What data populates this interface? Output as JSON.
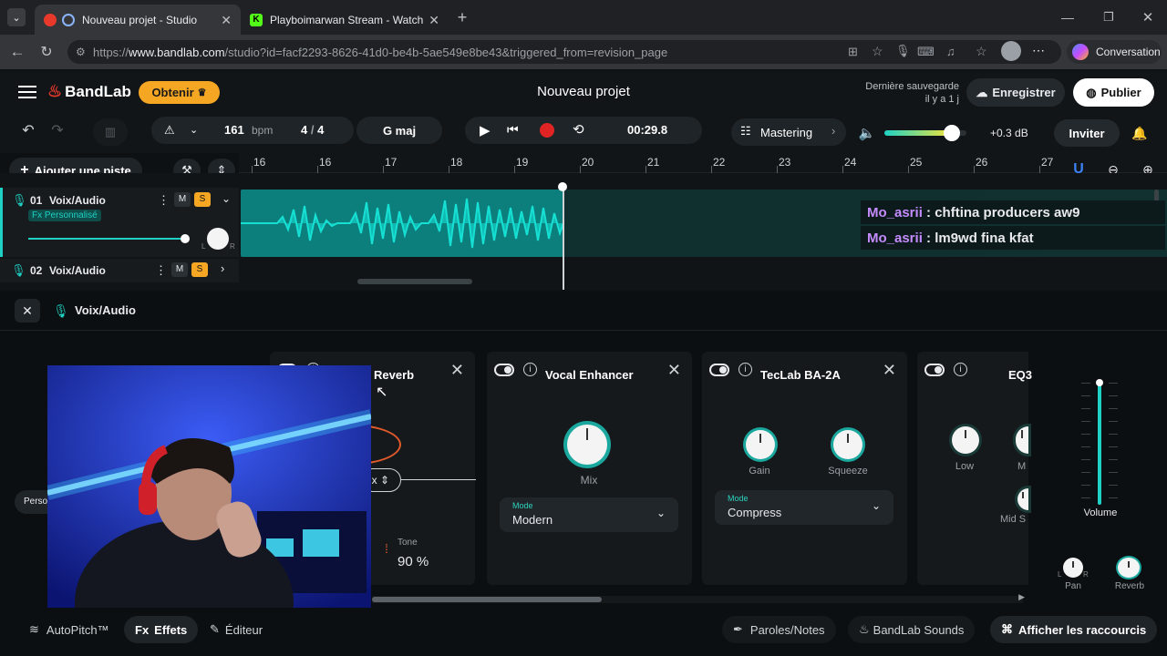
{
  "browser": {
    "tabs": [
      {
        "title": "Nouveau projet - Studio",
        "active": true
      },
      {
        "title": "Playboimarwan Stream - Watch Li",
        "active": false
      }
    ],
    "url_prefix": "https://",
    "url_domain": "www.bandlab.com",
    "url_path": "/studio?id=facf2293-8626-41d0-be4b-5ae549e8be43&triggered_from=revision_page",
    "copilot_label": "Conversation"
  },
  "app": {
    "brand": "BandLab",
    "get_button": "Obtenir",
    "project_title": "Nouveau projet",
    "last_saved_label": "Dernière sauvegarde",
    "last_saved_time": "il y a 1 j",
    "save_button": "Enregistrer",
    "publish_button": "Publier"
  },
  "toolbar": {
    "tempo": "161",
    "tempo_unit": "bpm",
    "time_sig_num": "4",
    "time_sig_sep": "/",
    "time_sig_den": "4",
    "key": "G maj",
    "time": "00:29.8",
    "mastering": "Mastering",
    "master_db": "+0.3 dB",
    "invite": "Inviter",
    "add_track": "Ajouter une piste",
    "master_volume_fraction": 0.82
  },
  "ruler": [
    "16",
    "16",
    "17",
    "18",
    "19",
    "20",
    "21",
    "22",
    "23",
    "24",
    "25",
    "26",
    "27"
  ],
  "tracks": [
    {
      "num": "01",
      "name": "Voix/Audio",
      "fx_badge": "Fx Personnalisé",
      "mute": "M",
      "solo": "S"
    },
    {
      "num": "02",
      "name": "Voix/Audio",
      "mute": "M",
      "solo": "S"
    }
  ],
  "chat": [
    {
      "user": "Mo_asrii",
      "sep": ":",
      "message": "chftina producers aw9"
    },
    {
      "user": "Mo_asrii",
      "sep": ":",
      "message": "lm9wd fina kfat"
    }
  ],
  "fx_panel": {
    "track_name": "Voix/Audio",
    "side_label": "Perso",
    "effects": [
      {
        "name": "Reverb",
        "select_suffix": "ix",
        "tone_label": "Tone",
        "tone_value": "90 %"
      },
      {
        "name": "Vocal Enhancer",
        "knob_label": "Mix",
        "mode_label": "Mode",
        "mode_value": "Modern"
      },
      {
        "name": "TecLab BA-2A",
        "knob1": "Gain",
        "knob2": "Squeeze",
        "mode_label": "Mode",
        "mode_value": "Compress"
      },
      {
        "name": "EQ3",
        "knob1": "Low",
        "knob2": "M",
        "knob3": "Mid S"
      }
    ],
    "volume_label": "Volume",
    "pan_label": "Pan",
    "reverb_label": "Reverb",
    "pan_l": "L",
    "pan_r": "R"
  },
  "bottom": {
    "autopitch": "AutoPitch™",
    "effects": "Effets",
    "editor": "Éditeur",
    "lyrics": "Paroles/Notes",
    "sounds": "BandLab Sounds",
    "shortcuts": "Afficher les raccourcis"
  },
  "colors": {
    "accent": "#f5a623",
    "teal": "#1fd1c4",
    "record": "#e02424",
    "brand_red": "#e8392b"
  }
}
